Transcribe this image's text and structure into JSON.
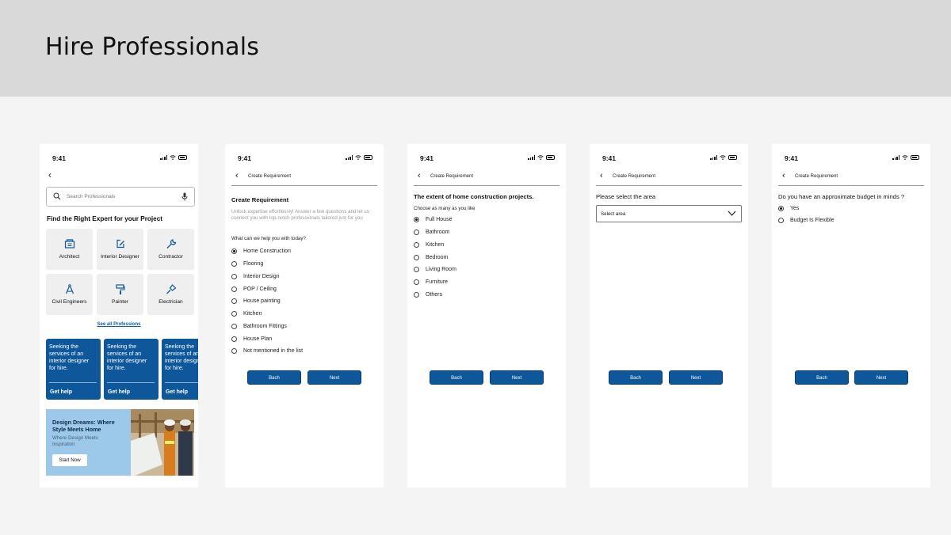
{
  "page": {
    "title": "Hire Professionals"
  },
  "status": {
    "time": "9:41"
  },
  "home": {
    "search_placeholder": "Search Professionals",
    "section_title": "Find the Right Expert for your Project",
    "categories": [
      {
        "label": "Architect",
        "icon": "building-icon"
      },
      {
        "label": "Interior Designer",
        "icon": "pen-square-icon"
      },
      {
        "label": "Contractor",
        "icon": "wrench-icon"
      },
      {
        "label": "Civil Engineers",
        "icon": "compass-icon"
      },
      {
        "label": "Painter",
        "icon": "paint-roller-icon"
      },
      {
        "label": "Electrician",
        "icon": "screwdriver-icon"
      }
    ],
    "see_all": "See all Professions",
    "cards": [
      {
        "text": "Seeking the services of an interior designer for hire.",
        "action": "Get help"
      },
      {
        "text": "Seeking the services of an interior designer for hire.",
        "action": "Get help"
      },
      {
        "text": "Seeking the services of an interior designer for hire.",
        "action": "Get help"
      }
    ],
    "banner": {
      "title": "Design Dreams: Where Style Meets Home",
      "subtitle": "Where Design Meets Inspiration",
      "button": "Start Now"
    }
  },
  "req1": {
    "header": "Create Requirement",
    "title": "Create Requirement",
    "description": "Unlock expertise effortlessly! Answer a few questions and let us connect you with top-notch professionals tailored just for you",
    "question": "What can we help you with today?",
    "options": [
      "Home Construction",
      "Flooring",
      "Interior Design",
      "POP / Ceiling",
      "House painting",
      "Kitchen",
      "Bathroom Fittings",
      "House Plan",
      "Not mentioned in the list"
    ],
    "selected": 0
  },
  "req2": {
    "header": "Create Requirement",
    "title": "The extent of home construction projects.",
    "subtitle": "Choose as many as you like",
    "options": [
      "Full House",
      "Bathroom",
      "Kitchen",
      "Bedroom",
      "Living Room",
      "Furniture",
      "Others"
    ],
    "selected": 0
  },
  "req3": {
    "header": "Create Requirement",
    "title": "Please select the area",
    "select_value": "Select area"
  },
  "req4": {
    "header": "Create Requirement",
    "title": "Do you have an approximate budget in minds ?",
    "options": [
      "Yes",
      "Budget Is Flexible"
    ],
    "selected": 0
  },
  "buttons": {
    "back": "Bach",
    "next": "Next"
  },
  "colors": {
    "primary": "#0d579a",
    "banner": "#9cc8ea",
    "header_bg": "#d9d9d9",
    "page_bg": "#f4f4f4"
  }
}
